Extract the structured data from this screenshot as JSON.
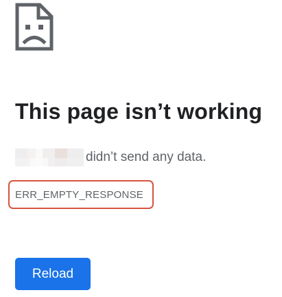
{
  "icon": {
    "name": "sad-page-icon",
    "stroke_color": "#5f6368"
  },
  "headline": "This page isn’t working",
  "message": {
    "host_redacted": true,
    "text": "didn’t send any data."
  },
  "error_code": {
    "text": "ERR_EMPTY_RESPONSE",
    "highlight_color": "#d6533f"
  },
  "reload_button": {
    "label": "Reload",
    "color": "#1a73e8"
  }
}
